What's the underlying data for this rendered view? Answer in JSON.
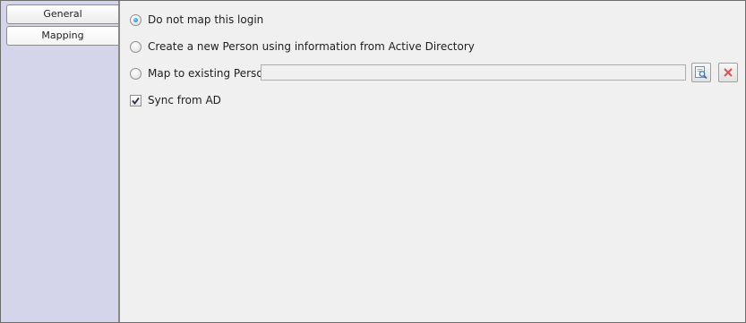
{
  "sidebar": {
    "tabs": [
      {
        "label": "General"
      },
      {
        "label": "Mapping"
      }
    ]
  },
  "mapping": {
    "options": [
      {
        "label": "Do not map this login",
        "selected": true
      },
      {
        "label": "Create a new Person using information from Active Directory",
        "selected": false
      },
      {
        "label": "Map to existing Person",
        "selected": false
      }
    ],
    "existing_person_value": "",
    "browse_icon": "browse-icon",
    "clear_icon": "clear-icon",
    "sync": {
      "label": "Sync from AD",
      "checked": true
    }
  },
  "colors": {
    "sidebar_bg": "#d4d5ea",
    "panel_bg": "#f0f0f0",
    "radio_selected": "#1b73b8",
    "clear_icon": "#d9534f"
  }
}
